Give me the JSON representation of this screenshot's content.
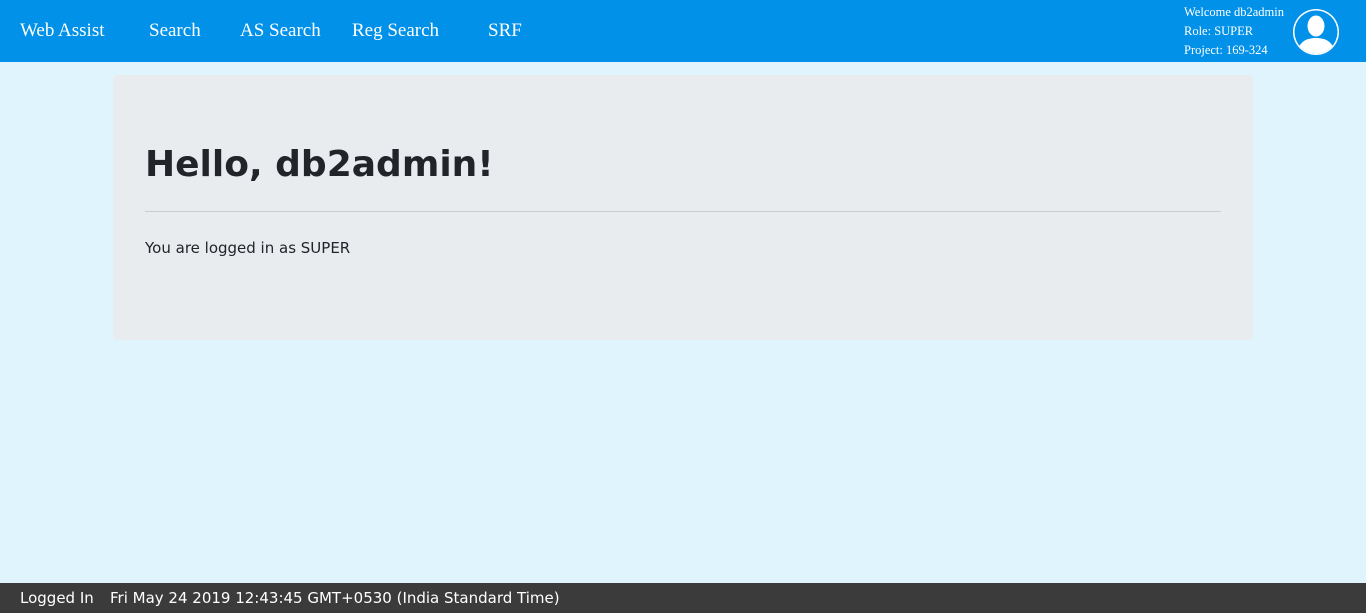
{
  "navbar": {
    "brand": "Web Assist",
    "links": [
      "Search",
      "AS Search",
      "Reg Search",
      "SRF"
    ],
    "background_color": "#0191e8"
  },
  "user": {
    "welcome": "Welcome db2admin",
    "role": "Role: SUPER",
    "project": "Project: 169-324",
    "avatar_icon": "user-avatar-icon"
  },
  "main": {
    "heading": "Hello, db2admin!",
    "message": "You are logged in as SUPER"
  },
  "footer": {
    "status": "Logged In",
    "datetime": "Fri May 24 2019 12:43:45 GMT+0530 (India Standard Time)",
    "background_color": "#3b3b3b"
  }
}
